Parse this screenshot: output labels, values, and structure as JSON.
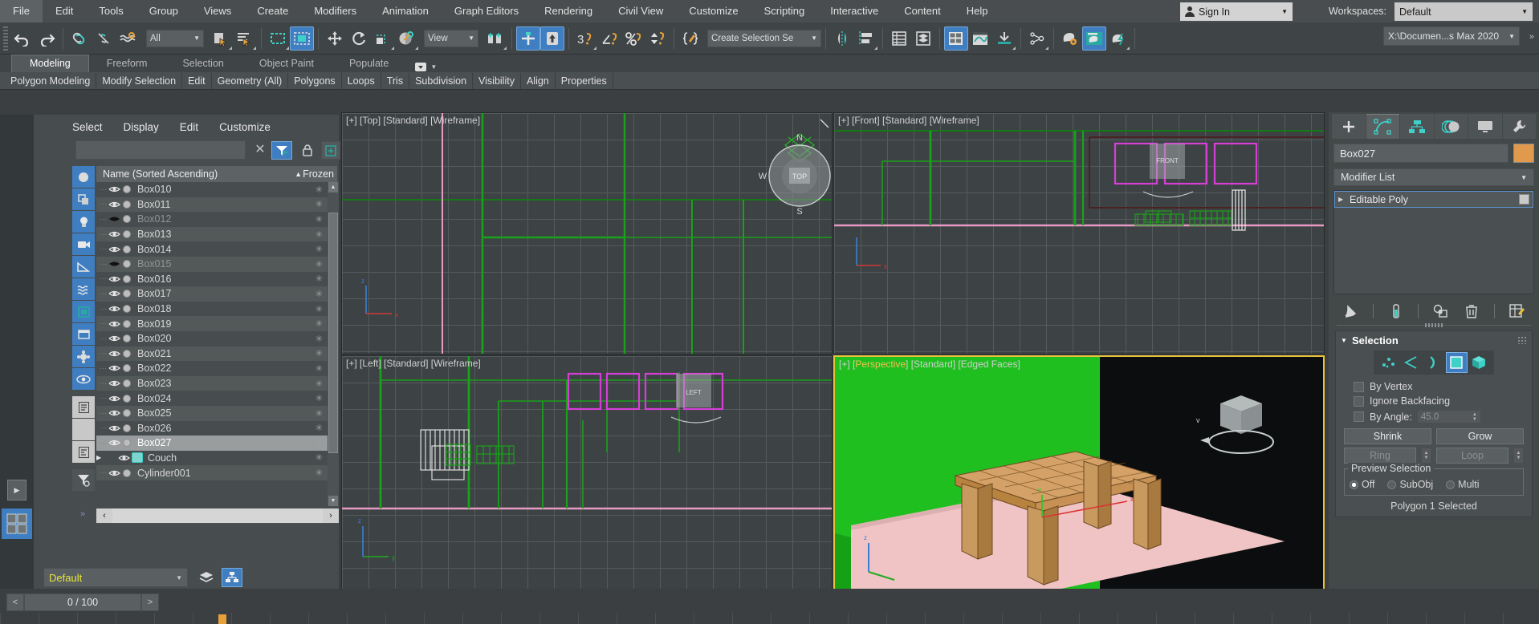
{
  "menu": {
    "items": [
      "File",
      "Edit",
      "Tools",
      "Group",
      "Views",
      "Create",
      "Modifiers",
      "Animation",
      "Graph Editors",
      "Rendering",
      "Civil View",
      "Customize",
      "Scripting",
      "Interactive",
      "Content",
      "Help"
    ],
    "sign_in": "Sign In",
    "workspaces_label": "Workspaces:",
    "workspace_value": "Default"
  },
  "toolbar": {
    "select_filter": "All",
    "reference_coord": "View",
    "selection_set": "Create Selection Se",
    "project_path": "X:\\Documen...s Max 2020"
  },
  "ribbon": {
    "tabs": [
      "Modeling",
      "Freeform",
      "Selection",
      "Object Paint",
      "Populate"
    ],
    "active_tab": "Modeling",
    "subtabs": [
      "Polygon Modeling",
      "Modify Selection",
      "Edit",
      "Geometry (All)",
      "Polygons",
      "Loops",
      "Tris",
      "Subdivision",
      "Visibility",
      "Align",
      "Properties"
    ]
  },
  "explorer": {
    "menu": [
      "Select",
      "Display",
      "Edit",
      "Customize"
    ],
    "search_value": "",
    "column_name": "Name (Sorted Ascending)",
    "column_frozen": "Frozen",
    "sort_arrow": "▲",
    "rows": [
      {
        "name": "Box010",
        "hidden": false,
        "selected": false
      },
      {
        "name": "Box011",
        "hidden": false,
        "selected": false
      },
      {
        "name": "Box012",
        "hidden": true,
        "selected": false
      },
      {
        "name": "Box013",
        "hidden": false,
        "selected": false
      },
      {
        "name": "Box014",
        "hidden": false,
        "selected": false
      },
      {
        "name": "Box015",
        "hidden": true,
        "selected": false
      },
      {
        "name": "Box016",
        "hidden": false,
        "selected": false
      },
      {
        "name": "Box017",
        "hidden": false,
        "selected": false
      },
      {
        "name": "Box018",
        "hidden": false,
        "selected": false
      },
      {
        "name": "Box019",
        "hidden": false,
        "selected": false
      },
      {
        "name": "Box020",
        "hidden": false,
        "selected": false
      },
      {
        "name": "Box021",
        "hidden": false,
        "selected": false
      },
      {
        "name": "Box022",
        "hidden": false,
        "selected": false
      },
      {
        "name": "Box023",
        "hidden": false,
        "selected": false
      },
      {
        "name": "Box024",
        "hidden": false,
        "selected": false
      },
      {
        "name": "Box025",
        "hidden": false,
        "selected": false
      },
      {
        "name": "Box026",
        "hidden": false,
        "selected": false
      },
      {
        "name": "Box027",
        "hidden": false,
        "selected": true
      },
      {
        "name": "Couch",
        "hidden": false,
        "selected": false,
        "group": true
      },
      {
        "name": "Cylinder001",
        "hidden": false,
        "selected": false
      }
    ]
  },
  "layer_bar": {
    "layer_name": "Default"
  },
  "timeline": {
    "frame_readout": "0 / 100",
    "prev": "<",
    "next": ">"
  },
  "viewports": [
    {
      "id": "vpTop",
      "label": "[+] [Top] [Standard] [Wireframe]"
    },
    {
      "id": "vpFront",
      "label": "[+] [Front] [Standard] [Wireframe]"
    },
    {
      "id": "vpLeft",
      "label": "[+] [Left] [Standard] [Wireframe]"
    },
    {
      "id": "vpPersp",
      "label_prefix": "[+] [",
      "label_persp": "Perspective",
      "label_suffix": "] [Standard] [Edged Faces]"
    }
  ],
  "command_panel": {
    "object_name": "Box027",
    "object_color": "#e09a4d",
    "modifier_list_label": "Modifier List",
    "stack_item": "Editable Poly",
    "selection": {
      "title": "Selection",
      "by_vertex": "By Vertex",
      "ignore_backfacing": "Ignore Backfacing",
      "by_angle": "By Angle:",
      "by_angle_value": "45.0",
      "shrink": "Shrink",
      "grow": "Grow",
      "ring": "Ring",
      "loop": "Loop",
      "preview_title": "Preview Selection",
      "preview_off": "Off",
      "preview_subobj": "SubObj",
      "preview_multi": "Multi",
      "status": "Polygon 1 Selected"
    }
  },
  "colors": {
    "accent_blue": "#3f7fc1",
    "accent_teal": "#3fd0c8",
    "highlight_yellow": "#e8c33a",
    "viewport_bg": "#3d4244"
  }
}
